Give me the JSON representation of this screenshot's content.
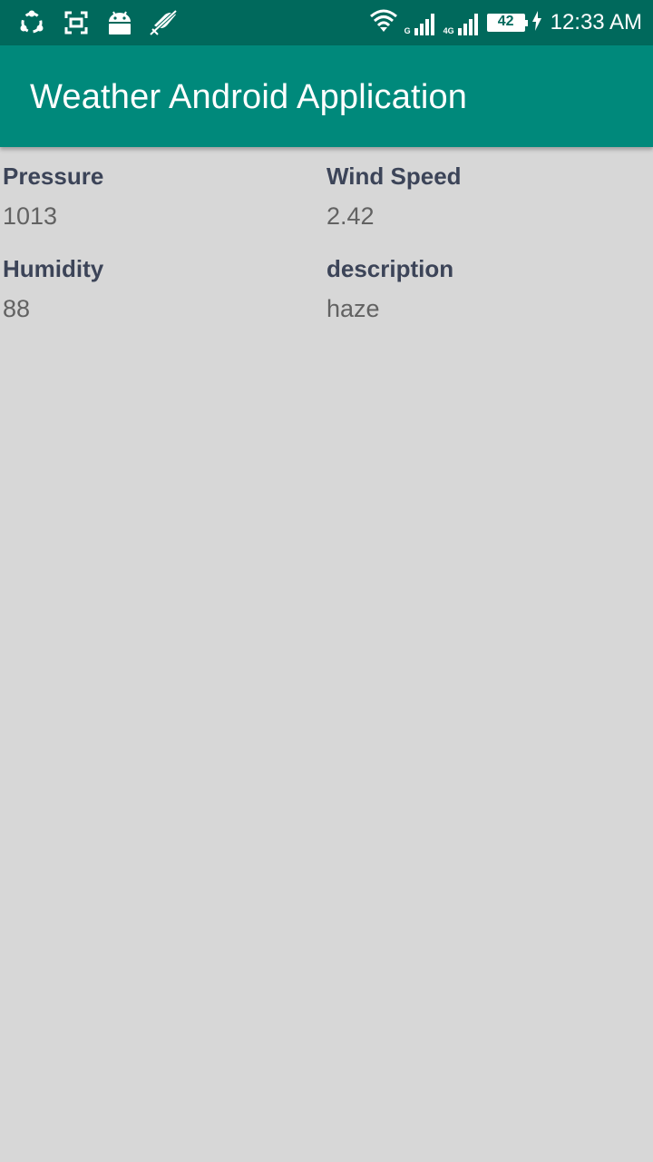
{
  "status_bar": {
    "icons_left": [
      "shareit-icon",
      "screenshot-icon",
      "android-icon",
      "no-vibrate-icon"
    ],
    "network_label_1": "G",
    "network_label_2": "4G",
    "battery_level": "42",
    "time": "12:33 AM"
  },
  "app_bar": {
    "title": "Weather Android Application"
  },
  "weather": {
    "pressure": {
      "label": "Pressure",
      "value": "1013"
    },
    "wind_speed": {
      "label": "Wind Speed",
      "value": "2.42"
    },
    "humidity": {
      "label": "Humidity",
      "value": "88"
    },
    "description": {
      "label": "description",
      "value": "haze"
    }
  },
  "colors": {
    "status_bar": "#00695c",
    "app_bar": "#00897b",
    "background": "#d7d7d7",
    "label_text": "#3c4458",
    "value_text": "#626262"
  }
}
